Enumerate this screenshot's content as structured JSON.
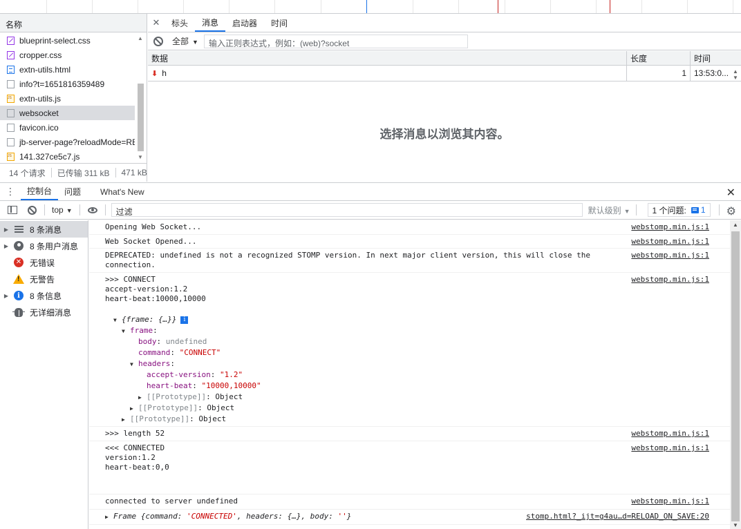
{
  "network": {
    "name_header": "名称",
    "requests": [
      {
        "name": "blueprint-select.css",
        "type": "css"
      },
      {
        "name": "cropper.css",
        "type": "css"
      },
      {
        "name": "extn-utils.html",
        "type": "html"
      },
      {
        "name": "info?t=1651816359489",
        "type": "other"
      },
      {
        "name": "extn-utils.js",
        "type": "js"
      },
      {
        "name": "websocket",
        "type": "other",
        "selected": true
      },
      {
        "name": "favicon.ico",
        "type": "other"
      },
      {
        "name": "jb-server-page?reloadMode=RE",
        "type": "other"
      },
      {
        "name": "141.327ce5c7.js",
        "type": "js"
      }
    ],
    "footer": {
      "requests": "14 个请求",
      "transferred": "已传输 311 kB",
      "resources": "471 kB"
    }
  },
  "messages": {
    "tabs": [
      "标头",
      "消息",
      "启动器",
      "时间"
    ],
    "active_tab": "消息",
    "filter_type": "全部",
    "filter_placeholder": "输入正则表达式，例如：(web)?socket",
    "columns": {
      "data": "数据",
      "length": "长度",
      "time": "时间"
    },
    "rows": [
      {
        "data": "h",
        "length": "1",
        "time": "13:53:0..."
      }
    ],
    "empty_text": "选择消息以浏览其内容。"
  },
  "drawer": {
    "tabs": [
      "控制台",
      "问题",
      "What's New"
    ],
    "active_tab": "控制台"
  },
  "console": {
    "context": "top",
    "filter_value": "过滤",
    "levels": "默认级别",
    "issues_label": "1 个问题:",
    "issues_count": "1",
    "sidebar": [
      {
        "label": "8 条消息",
        "icon": "list-icon",
        "expandable": true,
        "selected": true
      },
      {
        "label": "8 条用户消息",
        "icon": "user-icon",
        "expandable": true
      },
      {
        "label": "无错误",
        "icon": "error-icon",
        "expandable": false
      },
      {
        "label": "无警告",
        "icon": "warning-icon",
        "expandable": false
      },
      {
        "label": "8 条信息",
        "icon": "info-icon",
        "expandable": true
      },
      {
        "label": "无详细消息",
        "icon": "bug-icon",
        "expandable": false
      }
    ],
    "entries": [
      {
        "text": "Opening Web Socket...",
        "source": "webstomp.min.js:1"
      },
      {
        "text": "Web Socket Opened...",
        "source": "webstomp.min.js:1"
      },
      {
        "text": "DEPRECATED: undefined is not a recognized STOMP version. In next major client version, this will close the\nconnection.",
        "source": "webstomp.min.js:1"
      },
      {
        "text": ">>> CONNECT\naccept-version:1.2\nheart-beat:10000,10000",
        "source": "webstomp.min.js:1"
      },
      {
        "text": ">>> length 52",
        "source": "webstomp.min.js:1"
      },
      {
        "text": "<<< CONNECTED\nversion:1.2\nheart-beat:0,0",
        "source": "webstomp.min.js:1"
      },
      {
        "text": "connected to server undefined",
        "source": "webstomp.min.js:1"
      }
    ],
    "object_tree": {
      "summary": "{frame: {…}}",
      "frame_key": "frame",
      "body_key": "body",
      "body_value": "undefined",
      "command_key": "command",
      "command_value": "\"CONNECT\"",
      "headers_key": "headers",
      "accept_version_key": "accept-version",
      "accept_version_value": "\"1.2\"",
      "heart_beat_key": "heart-beat",
      "heart_beat_value": "\"10000,10000\"",
      "proto_key": "[[Prototype]]",
      "proto_value": "Object"
    },
    "frame_entry": {
      "prefix": "Frame {command: ",
      "command": "'CONNECTED'",
      "mid": ", headers: {…}, body: ",
      "body": "''",
      "suffix": "}",
      "source": "stomp.html?_ijt=g4au…d=RELOAD_ON_SAVE:20"
    }
  },
  "colors": {
    "accent": "#1a73e8",
    "error": "#d93025",
    "warning": "#f9ab00",
    "selection": "#dadce0"
  }
}
